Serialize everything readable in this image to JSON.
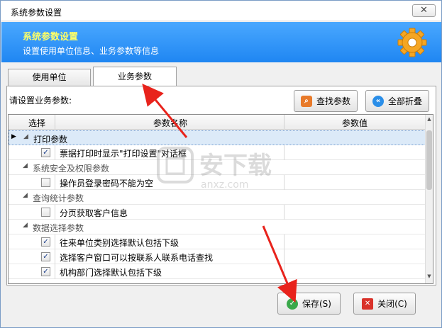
{
  "window": {
    "title": "系统参数设置",
    "close_label": "✕"
  },
  "banner": {
    "title": "系统参数设置",
    "subtitle": "设置使用单位信息、业务参数等信息",
    "icon": "gear-icon",
    "accent": "#ffff66",
    "bg": "#1f86f2"
  },
  "tabs": [
    {
      "label": "使用单位"
    },
    {
      "label": "业务参数"
    }
  ],
  "prompt": "请设置业务参数:",
  "toolbar": {
    "find_label": "查找参数",
    "collapse_label": "全部折叠"
  },
  "grid": {
    "columns": [
      "选择",
      "参数名称",
      "参数值"
    ],
    "rows": [
      {
        "type": "group",
        "label": "打印参数"
      },
      {
        "type": "item",
        "checked": true,
        "label": "票据打印时显示\"打印设置\"对话框"
      },
      {
        "type": "group",
        "label": "系统安全及权限参数"
      },
      {
        "type": "item",
        "checked": false,
        "label": "操作员登录密码不能为空"
      },
      {
        "type": "group",
        "label": "查询统计参数"
      },
      {
        "type": "item",
        "checked": false,
        "label": "分页获取客户信息"
      },
      {
        "type": "group",
        "label": "数据选择参数"
      },
      {
        "type": "item",
        "checked": true,
        "label": "往来单位类别选择默认包括下级"
      },
      {
        "type": "item",
        "checked": true,
        "label": "选择客户窗口可以按联系人联系电话查找"
      },
      {
        "type": "item",
        "checked": true,
        "label": "机构部门选择默认包括下级"
      }
    ]
  },
  "footer": {
    "save_label": "保存(S)",
    "close_label": "关闭(C)"
  },
  "watermark": {
    "text": "安下载",
    "sub": "anxz.com"
  }
}
